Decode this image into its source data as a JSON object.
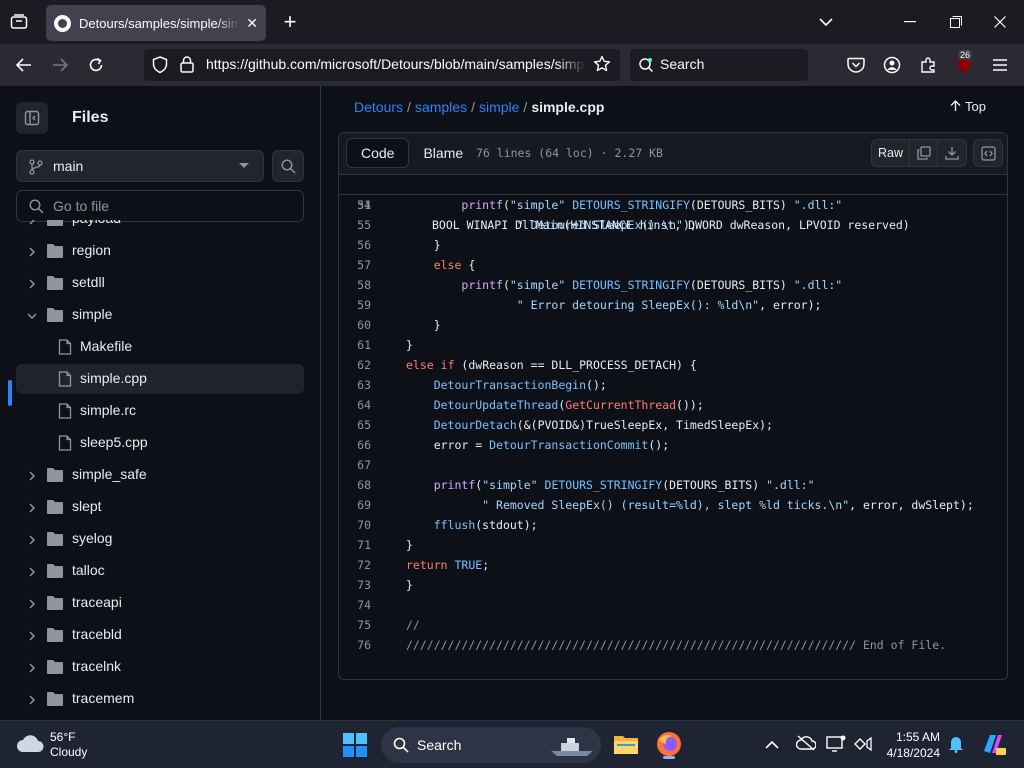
{
  "browser": {
    "tab_title": "Detours/samples/simple/simple.cpp at main · microsoft/Detours",
    "url": "https://github.com/microsoft/Detours/blob/main/samples/simple/simple.cpp",
    "search_label": "Search",
    "extensions_badge": "26"
  },
  "sidebar": {
    "title": "Files",
    "branch": "main",
    "goto_placeholder": "Go to file",
    "items": [
      {
        "label": "payload",
        "type": "folder",
        "depth": 0,
        "expanded": false
      },
      {
        "label": "region",
        "type": "folder",
        "depth": 0,
        "expanded": false
      },
      {
        "label": "setdll",
        "type": "folder",
        "depth": 0,
        "expanded": false
      },
      {
        "label": "simple",
        "type": "folder",
        "depth": 0,
        "expanded": true
      },
      {
        "label": "Makefile",
        "type": "file",
        "depth": 1
      },
      {
        "label": "simple.cpp",
        "type": "file",
        "depth": 1,
        "selected": true
      },
      {
        "label": "simple.rc",
        "type": "file",
        "depth": 1
      },
      {
        "label": "sleep5.cpp",
        "type": "file",
        "depth": 1
      },
      {
        "label": "simple_safe",
        "type": "folder",
        "depth": 0,
        "expanded": false
      },
      {
        "label": "slept",
        "type": "folder",
        "depth": 0,
        "expanded": false
      },
      {
        "label": "syelog",
        "type": "folder",
        "depth": 0,
        "expanded": false
      },
      {
        "label": "talloc",
        "type": "folder",
        "depth": 0,
        "expanded": false
      },
      {
        "label": "traceapi",
        "type": "folder",
        "depth": 0,
        "expanded": false
      },
      {
        "label": "tracebld",
        "type": "folder",
        "depth": 0,
        "expanded": false
      },
      {
        "label": "tracelnk",
        "type": "folder",
        "depth": 0,
        "expanded": false
      },
      {
        "label": "tracemem",
        "type": "folder",
        "depth": 0,
        "expanded": false
      }
    ]
  },
  "main": {
    "breadcrumb": {
      "repo": "Detours",
      "p1": "samples",
      "p2": "simple",
      "file": "simple.cpp"
    },
    "top_label": "Top",
    "tabs": {
      "code": "Code",
      "blame": "Blame"
    },
    "file_meta": "76 lines (64 loc) · 2.27 KB",
    "raw_label": "Raw",
    "sticky": {
      "num": "31",
      "text": "BOOL WINAPI DllMain(HINSTANCE hinst, DWORD dwReason, LPVOID reserved)"
    },
    "lines": [
      {
        "n": "54",
        "t": [
          [
            "",
            "        "
          ],
          [
            "fn",
            "printf"
          ],
          [
            "",
            "("
          ],
          [
            "str",
            "\"simple\""
          ],
          [
            "",
            " "
          ],
          [
            "mac",
            "DETOURS_STRINGIFY"
          ],
          [
            "",
            "(DETOURS_BITS) "
          ],
          [
            "str",
            "\".dll:\""
          ]
        ]
      },
      {
        "n": "55",
        "t": [
          [
            "",
            "                "
          ],
          [
            "str",
            "\" Detoured SleepEx().\\n\""
          ],
          [
            "",
            ");"
          ]
        ]
      },
      {
        "n": "56",
        "t": [
          [
            "",
            "    }"
          ]
        ]
      },
      {
        "n": "57",
        "t": [
          [
            "",
            "    "
          ],
          [
            "kw",
            "else"
          ],
          [
            "",
            " {"
          ]
        ]
      },
      {
        "n": "58",
        "t": [
          [
            "",
            "        "
          ],
          [
            "fn",
            "printf"
          ],
          [
            "",
            "("
          ],
          [
            "str",
            "\"simple\""
          ],
          [
            "",
            " "
          ],
          [
            "mac",
            "DETOURS_STRINGIFY"
          ],
          [
            "",
            "(DETOURS_BITS) "
          ],
          [
            "str",
            "\".dll:\""
          ]
        ]
      },
      {
        "n": "59",
        "t": [
          [
            "",
            "                "
          ],
          [
            "str",
            "\" Error detouring SleepEx(): %ld\\n\""
          ],
          [
            "",
            ", error);"
          ]
        ]
      },
      {
        "n": "60",
        "t": [
          [
            "",
            "    }"
          ]
        ]
      },
      {
        "n": "61",
        "t": [
          [
            "",
            "}"
          ]
        ]
      },
      {
        "n": "62",
        "t": [
          [
            "kw",
            "else"
          ],
          [
            "",
            " "
          ],
          [
            "kw",
            "if"
          ],
          [
            "",
            " (dwReason == DLL_PROCESS_DETACH) {"
          ]
        ]
      },
      {
        "n": "63",
        "t": [
          [
            "",
            "    "
          ],
          [
            "mac",
            "DetourTransactionBegin"
          ],
          [
            "",
            "();"
          ]
        ]
      },
      {
        "n": "64",
        "t": [
          [
            "",
            "    "
          ],
          [
            "mac",
            "DetourUpdateThread"
          ],
          [
            "",
            "("
          ],
          [
            "red",
            "GetCurrentThread"
          ],
          [
            "",
            "());"
          ]
        ]
      },
      {
        "n": "65",
        "t": [
          [
            "",
            "    "
          ],
          [
            "mac",
            "DetourDetach"
          ],
          [
            "",
            "(&(PVOID&)TrueSleepEx, TimedSleepEx);"
          ]
        ]
      },
      {
        "n": "66",
        "t": [
          [
            "",
            "    error = "
          ],
          [
            "mac",
            "DetourTransactionCommit"
          ],
          [
            "",
            "();"
          ]
        ]
      },
      {
        "n": "67",
        "t": [
          [
            "",
            ""
          ]
        ]
      },
      {
        "n": "68",
        "t": [
          [
            "",
            "    "
          ],
          [
            "fn",
            "printf"
          ],
          [
            "",
            "("
          ],
          [
            "str",
            "\"simple\""
          ],
          [
            "",
            " "
          ],
          [
            "mac",
            "DETOURS_STRINGIFY"
          ],
          [
            "",
            "(DETOURS_BITS) "
          ],
          [
            "str",
            "\".dll:\""
          ]
        ]
      },
      {
        "n": "69",
        "t": [
          [
            "",
            "           "
          ],
          [
            "str",
            "\" Removed SleepEx() (result=%ld), slept %ld ticks.\\n\""
          ],
          [
            "",
            ", error, dwSlept);"
          ]
        ]
      },
      {
        "n": "70",
        "t": [
          [
            "",
            "    "
          ],
          [
            "mac",
            "fflush"
          ],
          [
            "",
            "(stdout);"
          ]
        ]
      },
      {
        "n": "71",
        "t": [
          [
            "",
            "}"
          ]
        ]
      },
      {
        "n": "72",
        "t": [
          [
            "kw",
            "return"
          ],
          [
            "",
            " "
          ],
          [
            "mac",
            "TRUE"
          ],
          [
            "",
            ";"
          ]
        ]
      },
      {
        "n": "73",
        "t": [
          [
            "",
            "}"
          ]
        ]
      },
      {
        "n": "74",
        "t": [
          [
            "",
            ""
          ]
        ]
      },
      {
        "n": "75",
        "t": [
          [
            "cmt",
            "//"
          ]
        ]
      },
      {
        "n": "76",
        "t": [
          [
            "cmt",
            "///////////////////////////////////////////////////////////////// End of File."
          ]
        ]
      }
    ]
  },
  "taskbar": {
    "weather_temp": "56°F",
    "weather_desc": "Cloudy",
    "search_label": "Search",
    "time": "1:55 AM",
    "date": "4/18/2024"
  }
}
